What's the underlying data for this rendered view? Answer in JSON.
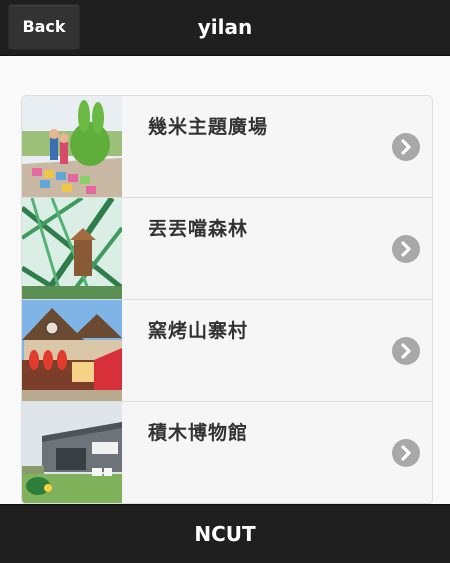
{
  "header": {
    "back_label": "Back",
    "title": "yilan"
  },
  "list": {
    "items": [
      {
        "label": "幾米主題廣場",
        "image": "jimmy-square-photo",
        "action_icon": "chevron-right-icon"
      },
      {
        "label": "丟丟噹森林",
        "image": "diudiudang-forest-photo",
        "action_icon": "chevron-right-icon"
      },
      {
        "label": "窯烤山寨村",
        "image": "kiln-village-photo",
        "action_icon": "chevron-right-icon"
      },
      {
        "label": "積木博物館",
        "image": "block-museum-photo",
        "action_icon": "chevron-right-icon"
      }
    ]
  },
  "footer": {
    "text": "NCUT"
  },
  "colors": {
    "bar": "#1f1f1f",
    "back_button": "#333333",
    "list_bg": "#f6f6f6",
    "chevron": "#a8a8a8"
  }
}
